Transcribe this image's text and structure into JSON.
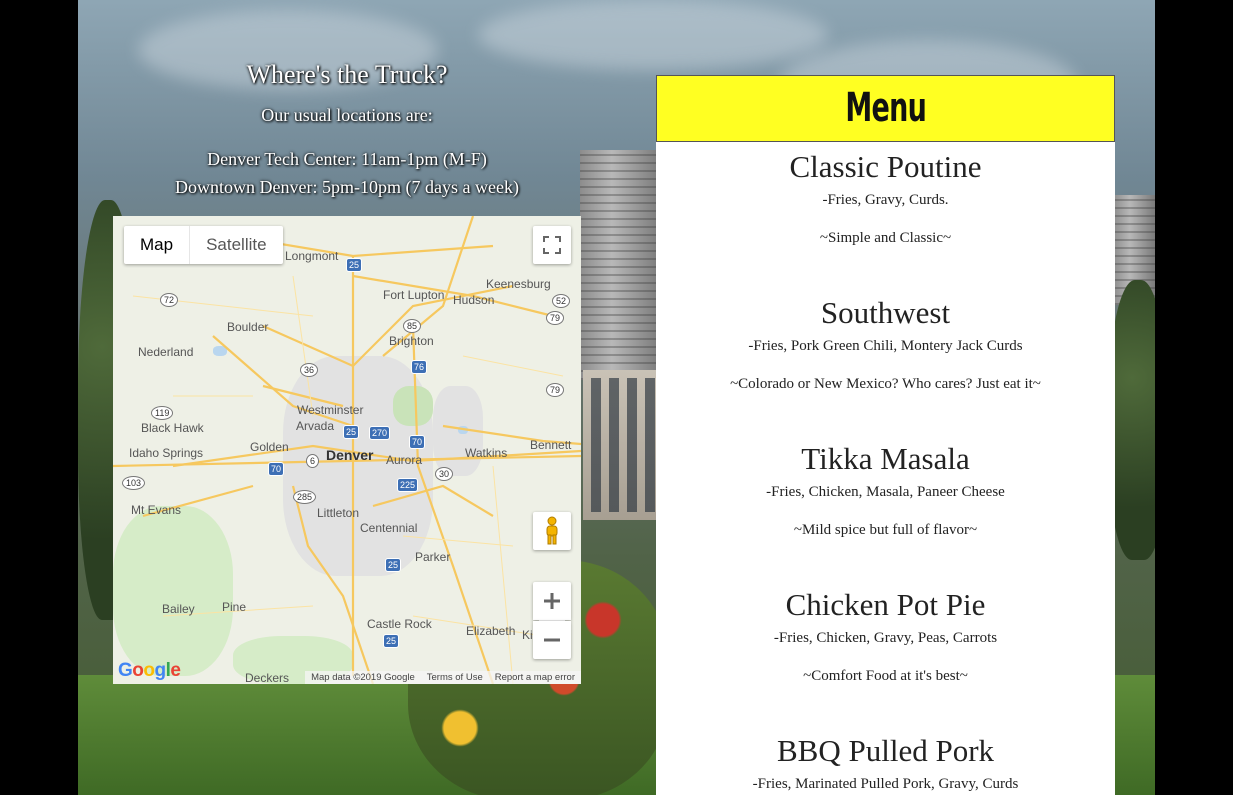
{
  "locations": {
    "title": "Where's the Truck?",
    "subtitle": "Our usual locations are:",
    "spots": [
      "Denver Tech Center: 11am-1pm (M-F)",
      "Downtown Denver: 5pm-10pm (7 days a week)"
    ]
  },
  "map": {
    "type_buttons": [
      "Map",
      "Satellite"
    ],
    "active_type": "Map",
    "places": [
      "Longmont",
      "Keenesburg",
      "Fort Lupton",
      "Hudson",
      "Boulder",
      "Brighton",
      "Nederland",
      "Westminster",
      "Arvada",
      "Black Hawk",
      "Golden",
      "Denver",
      "Aurora",
      "Watkins",
      "Bennett",
      "Idaho Springs",
      "Mt Evans",
      "Littleton",
      "Centennial",
      "Parker",
      "Bailey",
      "Pine",
      "Castle Rock",
      "Elizabeth",
      "Deckers",
      "Kio"
    ],
    "shields": [
      "25",
      "85",
      "76",
      "36",
      "72",
      "52",
      "79",
      "79",
      "119",
      "270",
      "70",
      "6",
      "25",
      "70",
      "30",
      "225",
      "285",
      "103",
      "25",
      "25"
    ],
    "logo": "Google",
    "footer": [
      "Map data ©2019 Google",
      "Terms of Use",
      "Report a map error"
    ]
  },
  "menu": {
    "title": "Menu",
    "items": [
      {
        "name": "Classic Poutine",
        "ingredients": "-Fries, Gravy, Curds.",
        "description": "~Simple and Classic~"
      },
      {
        "name": "Southwest",
        "ingredients": "-Fries, Pork Green Chili, Montery Jack Curds",
        "description": "~Colorado or New Mexico? Who cares? Just eat it~"
      },
      {
        "name": "Tikka Masala",
        "ingredients": "-Fries, Chicken, Masala, Paneer Cheese",
        "description": "~Mild spice but full of flavor~"
      },
      {
        "name": "Chicken Pot Pie",
        "ingredients": "-Fries, Chicken, Gravy, Peas, Carrots",
        "description": "~Comfort Food at it's best~"
      },
      {
        "name": "BBQ Pulled Pork",
        "ingredients": "-Fries, Marinated Pulled Pork, Gravy, Curds",
        "description": ""
      }
    ]
  },
  "colors": {
    "menu_header": "#ffff22",
    "shield_blue": "#3d6fb5"
  }
}
